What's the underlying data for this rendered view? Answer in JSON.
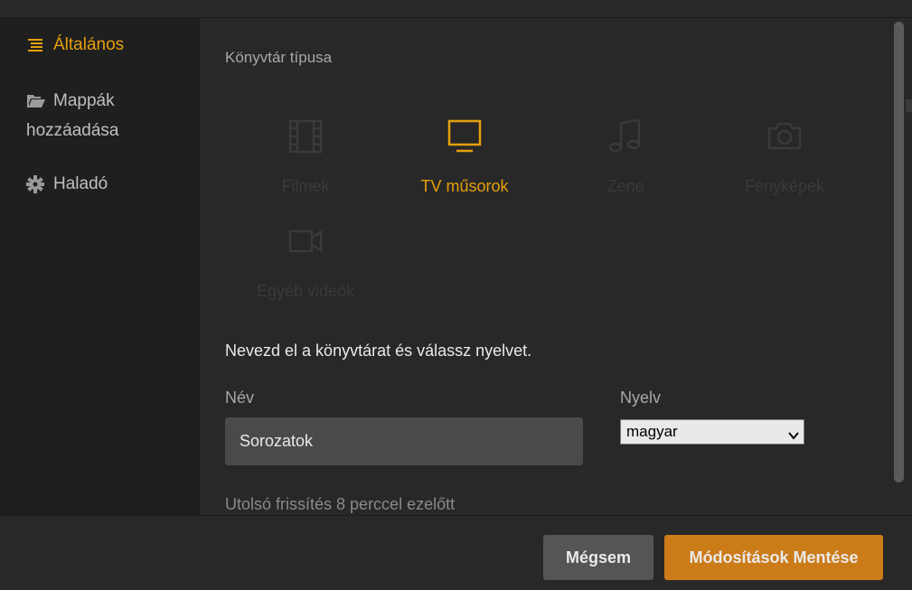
{
  "sidebar": {
    "items": [
      {
        "label": "Általános",
        "icon": "list-icon",
        "active": true
      },
      {
        "label_line1": "Mappák",
        "label_line2": "hozzáadása",
        "icon": "folder-open-icon"
      },
      {
        "label": "Haladó",
        "icon": "gear-icon"
      }
    ]
  },
  "main": {
    "section_title": "Könyvtár típusa",
    "types": [
      {
        "label": "Filmek",
        "icon": "film-icon"
      },
      {
        "label": "TV műsorok",
        "icon": "tv-icon",
        "selected": true
      },
      {
        "label": "Zene",
        "icon": "music-note-icon"
      },
      {
        "label": "Fényképek",
        "icon": "camera-icon"
      },
      {
        "label": "Egyéb videók",
        "icon": "video-camera-icon"
      }
    ],
    "name_heading": "Nevezd el a könyvtárat és válassz nyelvet.",
    "name_label": "Név",
    "name_value": "Sorozatok",
    "language_label": "Nyelv",
    "language_value": "magyar",
    "last_updated": "Utolsó frissítés 8 perccel ezelőtt"
  },
  "footer": {
    "cancel_label": "Mégsem",
    "save_label": "Módosítások Mentése"
  },
  "colors": {
    "accent": "#e5a00d",
    "save_button": "#cc7b19",
    "background": "#282828",
    "sidebar_background": "#1f1f1f"
  }
}
